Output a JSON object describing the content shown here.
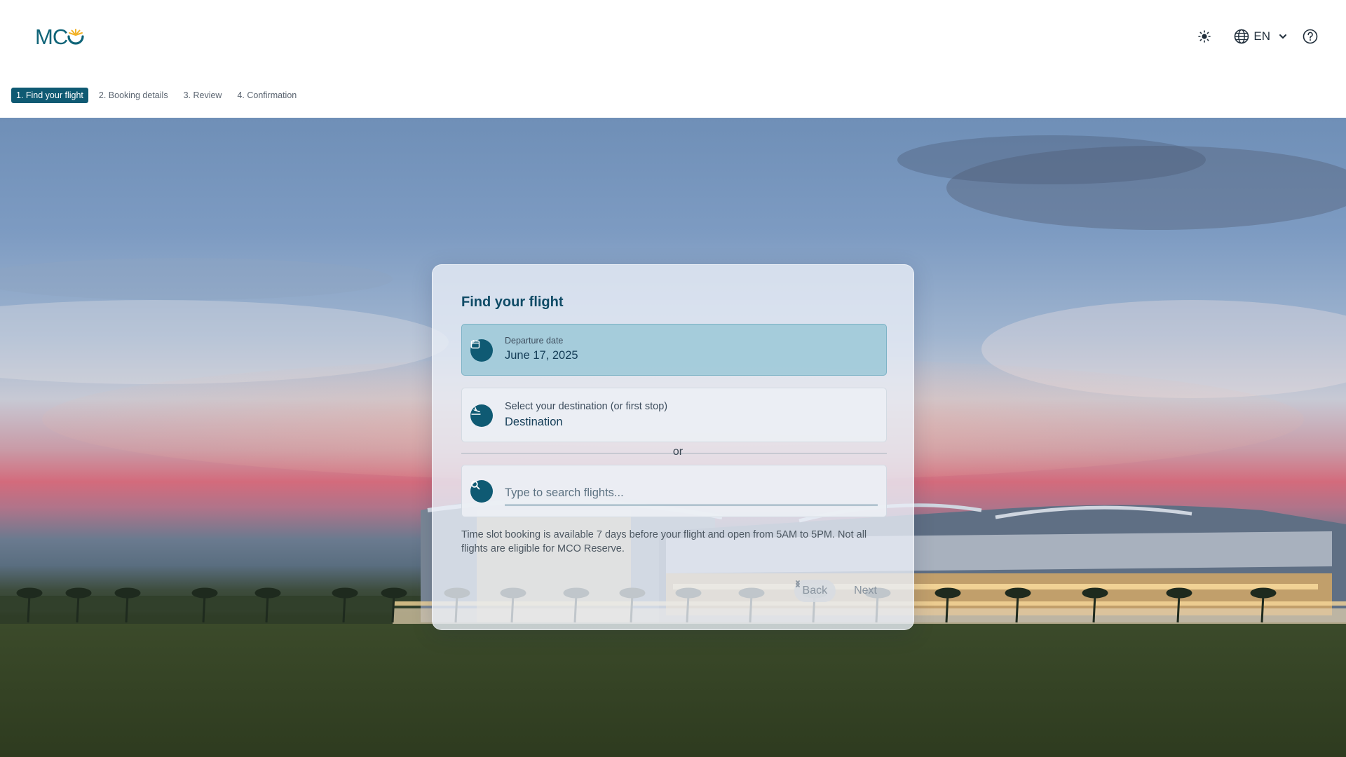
{
  "brand": {
    "logo_text": "MC",
    "accent": "#0f6478",
    "sun_color": "#f2b32a"
  },
  "header": {
    "theme_icon": "sun-icon",
    "language": {
      "icon": "globe-icon",
      "label": "EN",
      "chevron": "chevron-down-icon"
    },
    "help_icon": "help-circle-icon"
  },
  "stepper": {
    "steps": [
      {
        "label": "1. Find your flight",
        "active": true
      },
      {
        "label": "2. Booking details",
        "active": false
      },
      {
        "label": "3. Review",
        "active": false
      },
      {
        "label": "4. Confirmation",
        "active": false
      }
    ]
  },
  "card": {
    "title": "Find your flight",
    "departure": {
      "icon": "calendar-icon",
      "label": "Departure date",
      "value": "June 17, 2025"
    },
    "destination": {
      "icon": "plane-landing-icon",
      "label": "Select your destination (or first stop)",
      "value": "Destination"
    },
    "or_label": "or",
    "search": {
      "icon": "search-icon",
      "placeholder": "Type to search flights..."
    },
    "info": "Time slot booking is available 7 days before your flight and open from 5AM to 5PM. Not all flights are eligible for MCO Reserve.",
    "back_label": "Back",
    "next_label": "Next"
  },
  "colors": {
    "primary": "#0f5a73",
    "card_bg": "#e8eef6",
    "date_field_bg": "#9bc8d7"
  }
}
